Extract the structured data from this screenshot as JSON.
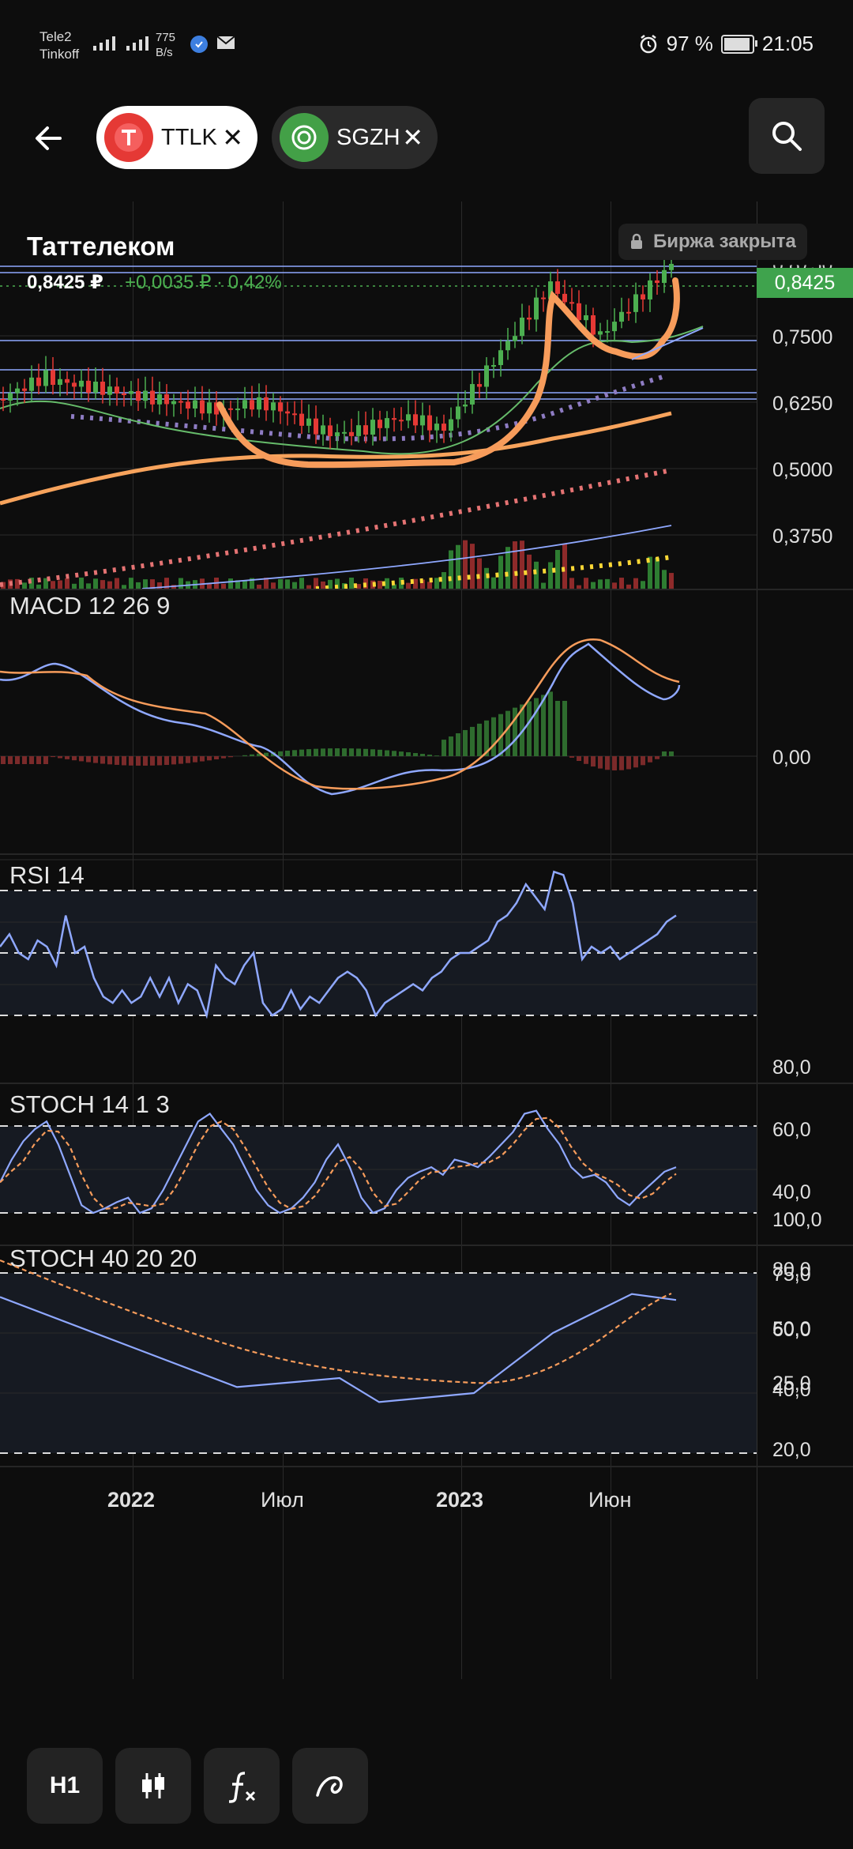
{
  "status_bar": {
    "carrier_line1": "Tele2",
    "carrier_line2": "Tinkoff",
    "net_speed_value": "775",
    "net_speed_unit": "B/s",
    "battery": "97 %",
    "time": "21:05"
  },
  "tabs": [
    {
      "ticker": "TTLK",
      "active": true,
      "logo_color": "#e53935"
    },
    {
      "ticker": "SGZH",
      "active": false,
      "logo_color": "#43a047"
    }
  ],
  "instrument": {
    "name": "Таттелеком",
    "price": "0,8425 ₽",
    "change": "+0,0035 ₽ · 0,42%",
    "market_status": "Биржа закрыта",
    "price_tag": "0,8425",
    "price_tag_hidden": "0,8750"
  },
  "price_axis": [
    "0,7500",
    "0,6250",
    "0,5000",
    "0,3750"
  ],
  "macd": {
    "title": "MACD 12 26 9",
    "axis": [
      "0,00"
    ]
  },
  "rsi": {
    "title": "RSI 14",
    "axis": [
      "80,0",
      "60,0",
      "40,0"
    ]
  },
  "stoch1": {
    "title": "STOCH 14 1 3",
    "axis": [
      "100,0",
      "75,0",
      "50,0",
      "25,0"
    ]
  },
  "stoch2": {
    "title": "STOCH 40 20 20",
    "axis": [
      "80,0",
      "60,0",
      "40,0",
      "20,0"
    ]
  },
  "time_axis": [
    "2022",
    "Июл",
    "2023",
    "Июн"
  ],
  "bottom_tools": {
    "timeframe": "H1"
  },
  "colors": {
    "bull": "#4caf50",
    "bear": "#e53935",
    "accent_orange": "#f7a35c",
    "line_blue": "#8fa8ff",
    "ma_purple": "#8e7cc3",
    "ma_red": "#e57373",
    "ma_yellow": "#fdd835"
  },
  "chart_data": [
    {
      "type": "line",
      "title": "RSI 14",
      "x": [
        "2022",
        "Июл",
        "2023",
        "Июн"
      ],
      "series": [
        {
          "values": [
            62,
            46,
            40,
            48,
            60,
            85,
            58,
            72
          ]
        }
      ],
      "ylim": [
        25,
        90
      ]
    },
    {
      "type": "line",
      "title": "STOCH 40 20 20",
      "x": [
        "2022",
        "Июл",
        "2023",
        "Июн"
      ],
      "series": [
        {
          "values": [
            72,
            55,
            42,
            45,
            37,
            40,
            60,
            73,
            71
          ]
        }
      ],
      "ylim": [
        15,
        85
      ]
    }
  ]
}
